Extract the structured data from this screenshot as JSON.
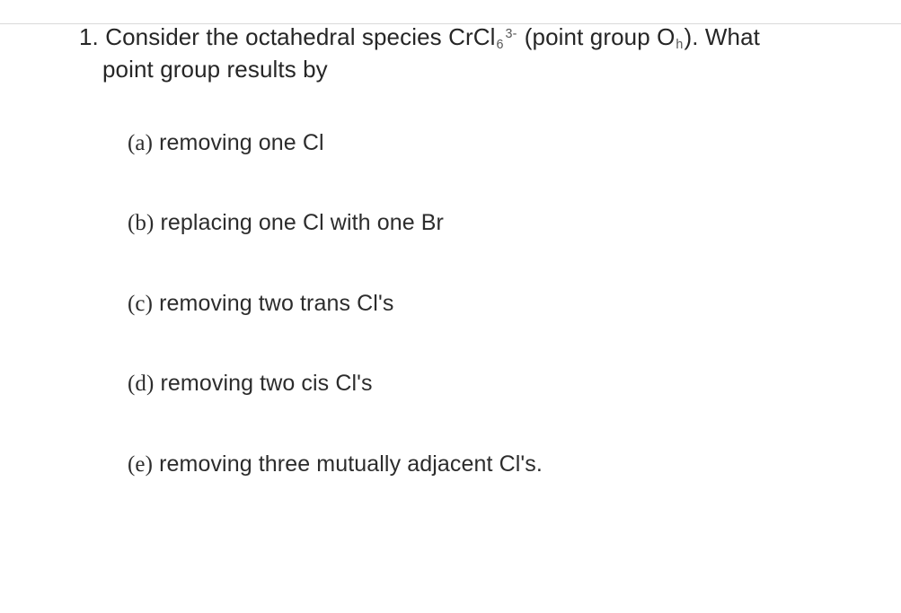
{
  "question": {
    "number": "1.",
    "stem_before_formula": "Consider the octahedral species ",
    "formula": {
      "base": "CrCl",
      "sub": "6",
      "sup": "3-"
    },
    "stem_mid": " (point group ",
    "group": {
      "base": "O",
      "sub": "h"
    },
    "stem_after_group": "). What",
    "stem_line2": "point group results by"
  },
  "options": [
    {
      "label": "(a)",
      "text": " removing one Cl"
    },
    {
      "label": "(b)",
      "text": " replacing one Cl with one Br"
    },
    {
      "label": "(c)",
      "text": " removing two trans Cl's"
    },
    {
      "label": "(d)",
      "text": " removing two cis Cl's"
    },
    {
      "label": "(e)",
      "text": " removing three mutually adjacent Cl's."
    }
  ]
}
